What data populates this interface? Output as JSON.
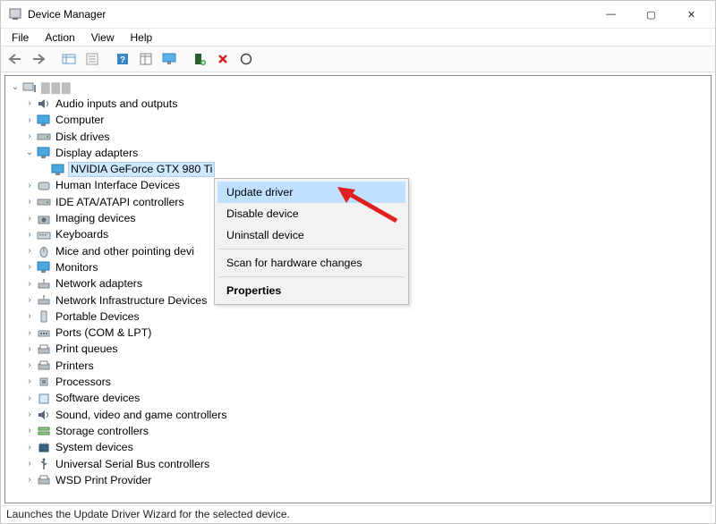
{
  "window": {
    "title": "Device Manager",
    "controls": {
      "min": "—",
      "max": "▢",
      "close": "✕"
    }
  },
  "menu": [
    "File",
    "Action",
    "View",
    "Help"
  ],
  "tree": {
    "rootLabel": "▇▇▇",
    "selectedIndex": 3,
    "expandedCategoryIndex": 3,
    "items": [
      {
        "label": "Audio inputs and outputs",
        "icon": "speaker"
      },
      {
        "label": "Computer",
        "icon": "monitor"
      },
      {
        "label": "Disk drives",
        "icon": "drive"
      },
      {
        "label": "Display adapters",
        "icon": "monitor",
        "expanded": true,
        "children": [
          {
            "label": "NVIDIA GeForce GTX 980 Ti",
            "icon": "monitor",
            "selected": true
          }
        ]
      },
      {
        "label": "Human Interface Devices",
        "icon": "hid"
      },
      {
        "label": "IDE ATA/ATAPI controllers",
        "icon": "drive"
      },
      {
        "label": "Imaging devices",
        "icon": "camera"
      },
      {
        "label": "Keyboards",
        "icon": "keyboard"
      },
      {
        "label": "Mice and other pointing devi",
        "icon": "mouse"
      },
      {
        "label": "Monitors",
        "icon": "monitor"
      },
      {
        "label": "Network adapters",
        "icon": "network"
      },
      {
        "label": "Network Infrastructure Devices",
        "icon": "network"
      },
      {
        "label": "Portable Devices",
        "icon": "portable"
      },
      {
        "label": "Ports (COM & LPT)",
        "icon": "port"
      },
      {
        "label": "Print queues",
        "icon": "printer"
      },
      {
        "label": "Printers",
        "icon": "printer"
      },
      {
        "label": "Processors",
        "icon": "cpu"
      },
      {
        "label": "Software devices",
        "icon": "software"
      },
      {
        "label": "Sound, video and game controllers",
        "icon": "speaker"
      },
      {
        "label": "Storage controllers",
        "icon": "storage"
      },
      {
        "label": "System devices",
        "icon": "chip"
      },
      {
        "label": "Universal Serial Bus controllers",
        "icon": "usb"
      },
      {
        "label": "WSD Print Provider",
        "icon": "printer"
      }
    ]
  },
  "context_menu": {
    "items": [
      {
        "label": "Update driver",
        "highlight": true
      },
      {
        "label": "Disable device"
      },
      {
        "label": "Uninstall device"
      },
      {
        "sep": true
      },
      {
        "label": "Scan for hardware changes"
      },
      {
        "sep": true
      },
      {
        "label": "Properties",
        "bold": true
      }
    ]
  },
  "status_bar": "Launches the Update Driver Wizard for the selected device.",
  "toolbar_icons": [
    "back",
    "forward",
    "sep",
    "show-hidden",
    "properties",
    "sep",
    "help",
    "refresh",
    "monitor",
    "sep",
    "add",
    "remove",
    "scan"
  ]
}
